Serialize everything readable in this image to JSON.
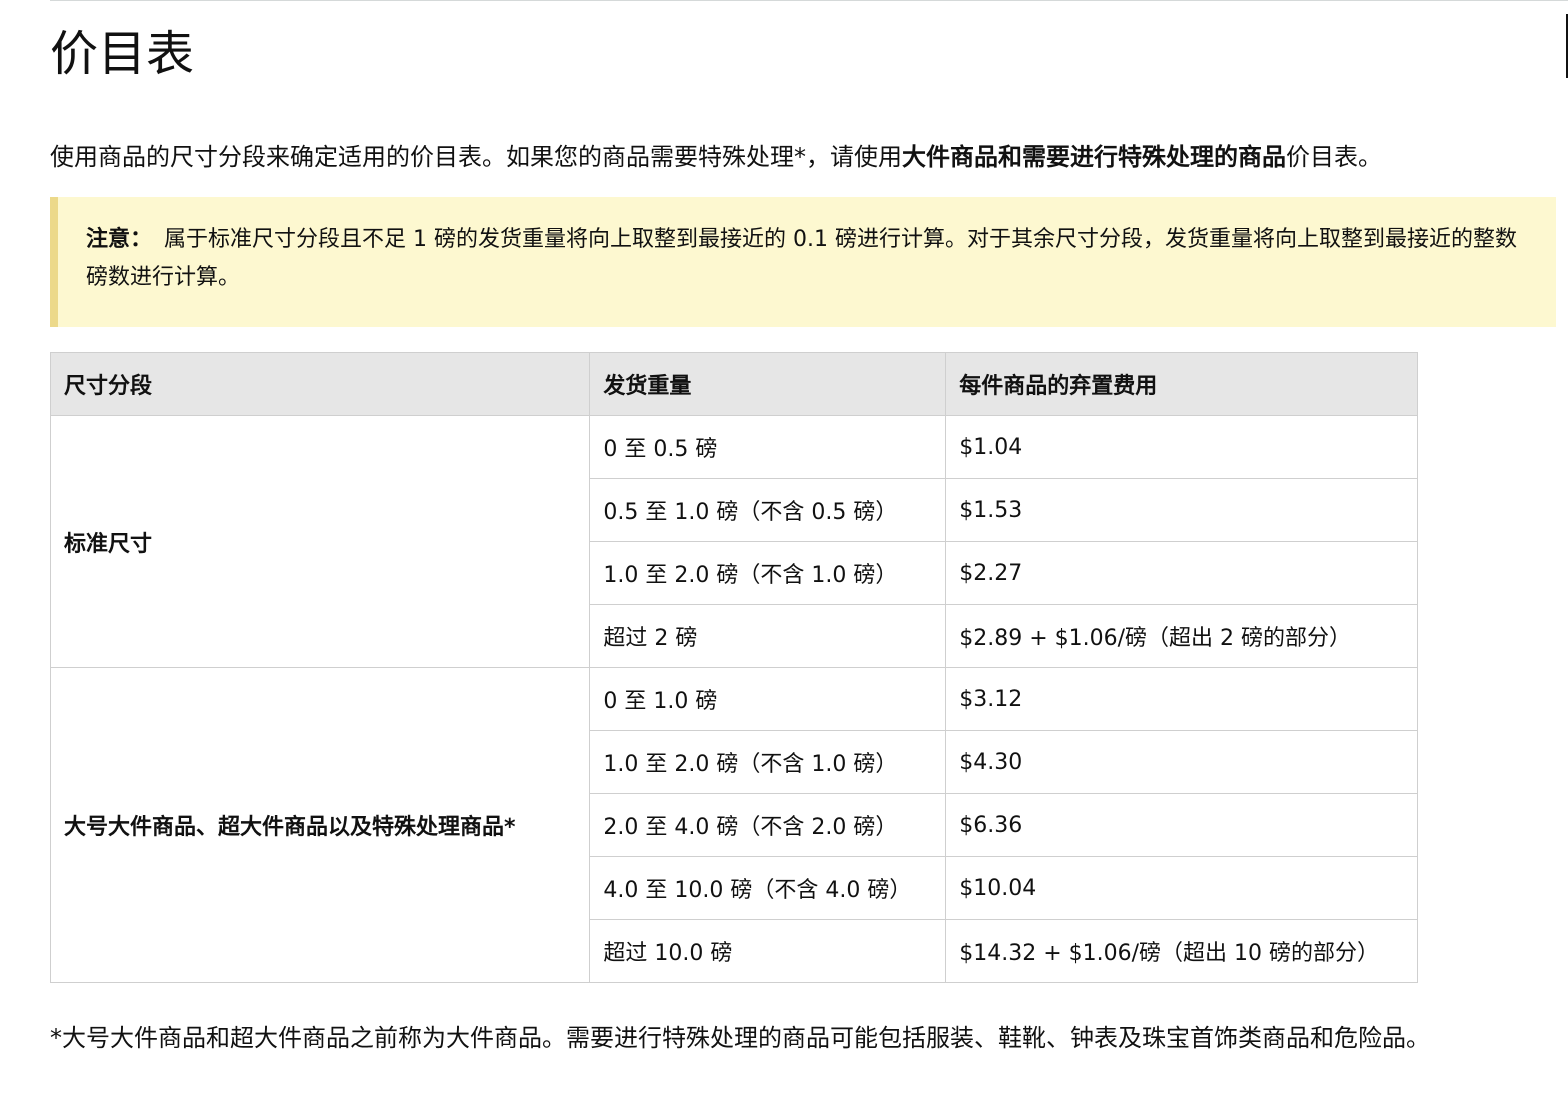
{
  "title": "价目表",
  "intro": {
    "text_before": "使用商品的尺寸分段来确定适用的价目表。如果您的商品需要特殊处理*，请使用",
    "bold": "大件商品和需要进行特殊处理的商品",
    "text_after": "价目表。"
  },
  "note": {
    "label": "注意：",
    "text": "属于标准尺寸分段且不足 1 磅的发货重量将向上取整到最接近的 0.1 磅进行计算。对于其余尺寸分段，发货重量将向上取整到最接近的整数磅数进行计算。"
  },
  "table": {
    "headers": [
      "尺寸分段",
      "发货重量",
      "每件商品的弃置费用"
    ],
    "groups": [
      {
        "tier": "标准尺寸",
        "rows": [
          {
            "weight": "0 至 0.5 磅",
            "fee": "$1.04"
          },
          {
            "weight": "0.5 至 1.0 磅（不含 0.5 磅）",
            "fee": "$1.53"
          },
          {
            "weight": "1.0 至 2.0 磅（不含 1.0 磅）",
            "fee": "$2.27"
          },
          {
            "weight": "超过 2 磅",
            "fee": "$2.89 + $1.06/磅（超出 2 磅的部分）"
          }
        ]
      },
      {
        "tier": "大号大件商品、超大件商品以及特殊处理商品*",
        "rows": [
          {
            "weight": "0 至 1.0 磅",
            "fee": "$3.12"
          },
          {
            "weight": "1.0 至 2.0 磅（不含 1.0 磅）",
            "fee": "$4.30"
          },
          {
            "weight": "2.0 至 4.0 磅（不含 2.0 磅）",
            "fee": "$6.36"
          },
          {
            "weight": "4.0 至 10.0 磅（不含 4.0 磅）",
            "fee": "$10.04"
          },
          {
            "weight": "超过 10.0 磅",
            "fee": "$14.32 + $1.06/磅（超出 10 磅的部分）"
          }
        ]
      }
    ]
  },
  "footnote": "*大号大件商品和超大件商品之前称为大件商品。需要进行特殊处理的商品可能包括服装、鞋靴、钟表及珠宝首饰类商品和危险品。"
}
